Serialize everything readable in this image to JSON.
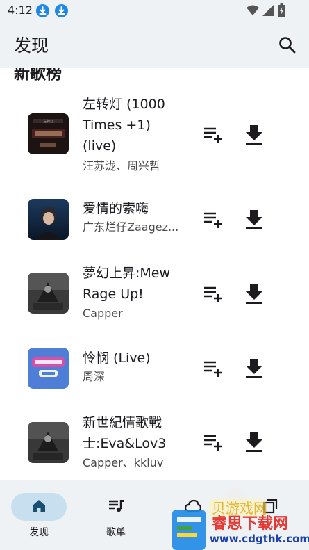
{
  "status_bar": {
    "time": "4:12"
  },
  "app_bar": {
    "title": "发现"
  },
  "section": {
    "heading": "新歌榜"
  },
  "songs": [
    {
      "title": "左转灯 (1000 Times +1) (live)",
      "artist": "汪苏泷、周兴哲"
    },
    {
      "title": "爱情的索嗨",
      "artist": "广东烂仔Zaagez..."
    },
    {
      "title": "夢幻上昇:Mew Rage Up!",
      "artist": "Capper"
    },
    {
      "title": "怜悯 (Live)",
      "artist": "周深"
    },
    {
      "title": "新世紀情歌戰士:Eva&Lov3",
      "artist": "Capper、kkluv"
    }
  ],
  "bottom_nav": {
    "items": [
      {
        "label": "发现",
        "icon": "home-icon",
        "active": true
      },
      {
        "label": "歌单",
        "icon": "playlist-icon",
        "active": false
      },
      {
        "label": "",
        "icon": "cloud-icon",
        "active": false
      },
      {
        "label": "",
        "icon": "settings-icon",
        "active": false
      }
    ]
  },
  "watermark": {
    "line1": "睿思下载网",
    "line2": "www.cdgthk.com",
    "tag": "贝游戏网"
  },
  "colors": {
    "bar_background": "#eef2f5",
    "active_nav_pill": "#c8dff0",
    "status_download_badge": "#1e88e5",
    "watermark_red": "#e53935",
    "watermark_blue": "#1e40af"
  }
}
